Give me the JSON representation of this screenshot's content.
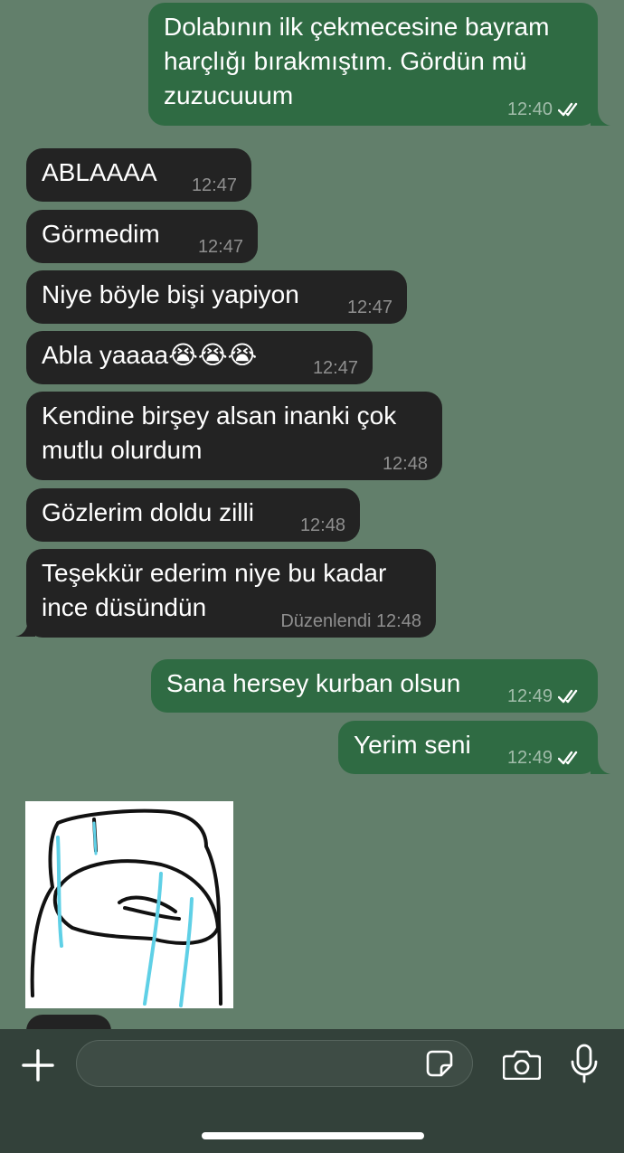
{
  "messages": [
    {
      "text": "Dolabının ilk çekmecesine bayram\nharçlığı bırakmıştım. Gördün mü\nzuzucuuum",
      "time": "12:40",
      "dir": "out"
    },
    {
      "text": "ABLAAAA",
      "time": "12:47",
      "dir": "in"
    },
    {
      "text": "Görmedim",
      "time": "12:47",
      "dir": "in"
    },
    {
      "text": "Niye böyle bişi yapiyon",
      "time": "12:47",
      "dir": "in"
    },
    {
      "text": "Abla yaaaa😭😭😭",
      "time": "12:47",
      "dir": "in"
    },
    {
      "text": "Kendine birşey alsan inanki çok\nmutlu olurdum",
      "time": "12:48",
      "dir": "in"
    },
    {
      "text": "Gözlerim doldu zilli",
      "time": "12:48",
      "dir": "in"
    },
    {
      "text": "Teşekkür ederim niye bu kadar\nince düsündün",
      "time": "Düzenlendi 12:48",
      "dir": "in"
    },
    {
      "text": "Sana hersey kurban olsun",
      "time": "12:49",
      "dir": "out"
    },
    {
      "text": "Yerim seni",
      "time": "12:49",
      "dir": "out"
    }
  ],
  "composer": {
    "placeholder": "",
    "icons": [
      "plus-icon",
      "sticker-icon",
      "camera-icon",
      "microphone-icon"
    ]
  },
  "colors": {
    "background": "#627f6b",
    "outgoing_bubble": "#2f6b43",
    "incoming_bubble": "#232323",
    "composer": "#33413a"
  }
}
